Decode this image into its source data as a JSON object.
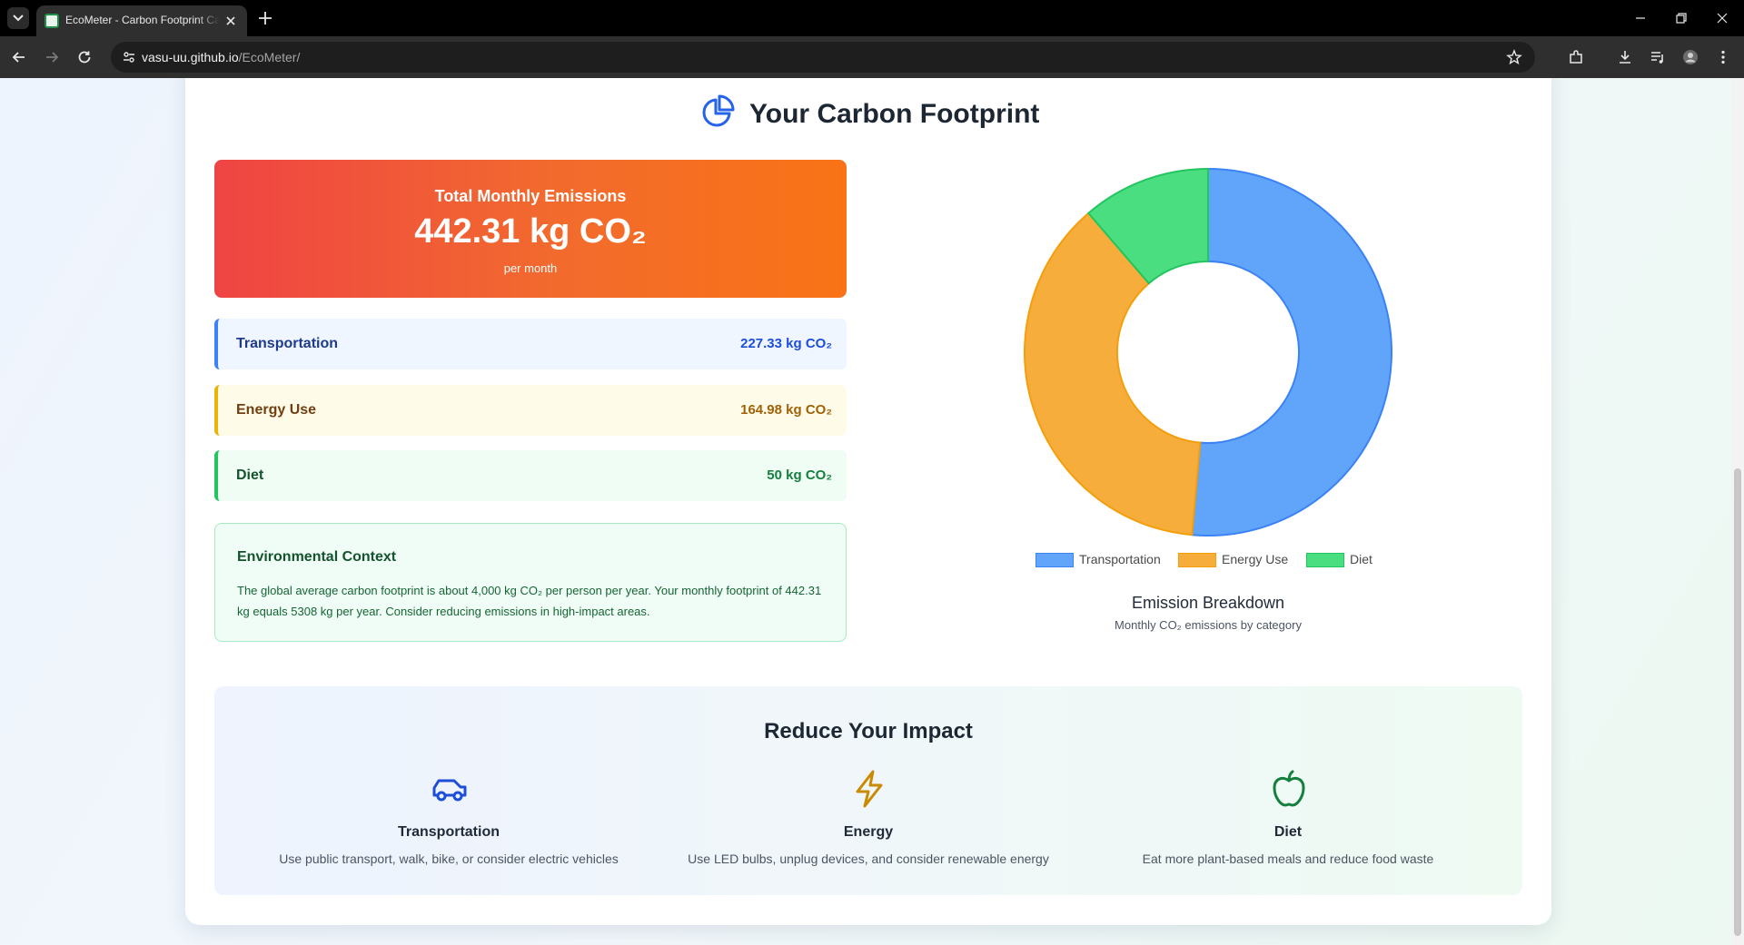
{
  "browser": {
    "tab_title": "EcoMeter - Carbon Footprint Calculator",
    "url_host": "vasu-uu.github.io",
    "url_path": "/EcoMeter/"
  },
  "page": {
    "title": "Your Carbon Footprint",
    "total": {
      "label": "Total Monthly Emissions",
      "value": "442.31 kg CO₂",
      "sub": "per month"
    },
    "categories": [
      {
        "name": "Transportation",
        "value": "227.33 kg CO₂"
      },
      {
        "name": "Energy Use",
        "value": "164.98 kg CO₂"
      },
      {
        "name": "Diet",
        "value": "50 kg CO₂"
      }
    ],
    "context": {
      "title": "Environmental Context",
      "text": "The global average carbon footprint is about 4,000 kg CO₂ per person per year. Your monthly footprint of 442.31 kg equals 5308 kg per year. Consider reducing emissions in high-impact areas."
    },
    "chart_caption": {
      "title": "Emission Breakdown",
      "subtitle": "Monthly CO₂ emissions by category"
    },
    "reduce": {
      "title": "Reduce Your Impact",
      "tips": [
        {
          "icon": "car-icon",
          "title": "Transportation",
          "text": "Use public transport, walk, bike, or consider electric vehicles"
        },
        {
          "icon": "lightning-icon",
          "title": "Energy",
          "text": "Use LED bulbs, unplug devices, and consider renewable energy"
        },
        {
          "icon": "apple-icon",
          "title": "Diet",
          "text": "Eat more plant-based meals and reduce food waste"
        }
      ]
    }
  },
  "chart_data": {
    "type": "pie",
    "variant": "doughnut",
    "categories": [
      "Transportation",
      "Energy Use",
      "Diet"
    ],
    "values": [
      227.33,
      164.98,
      50
    ],
    "colors": [
      "#60a5fa",
      "#f6ad3b",
      "#4ade80"
    ],
    "border_colors": [
      "#3b82f6",
      "#f59e0b",
      "#22c55e"
    ],
    "legend": "bottom",
    "title": "Emission Breakdown",
    "subtitle": "Monthly CO₂ emissions by category"
  }
}
